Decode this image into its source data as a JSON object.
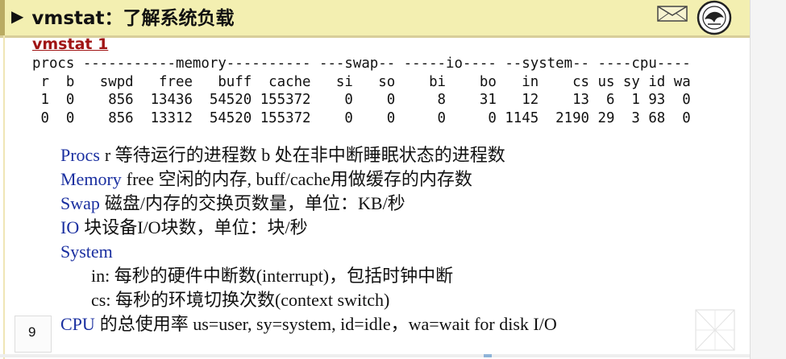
{
  "header": {
    "title_marker": "▶",
    "title": "vmstat：了解系统负载",
    "envelope_icon": "envelope-icon",
    "seal_icon": "university-seal-icon"
  },
  "subtitle": "vmstat 1",
  "terminal": {
    "group_row": "procs -----------memory---------- ---swap-- -----io---- --system-- ----cpu----",
    "header_row": " r  b   swpd   free   buff  cache   si   so    bi    bo   in    cs us sy id wa",
    "rows": [
      " 1  0    856  13436  54520 155372    0    0     8    31   12    13  6  1 93  0",
      " 0  0    856  13312  54520 155372    0    0     0     0 1145  2190 29  3 68  0"
    ]
  },
  "notes": [
    {
      "keyword": "Procs",
      "text": "r 等待运行的进程数 b 处在非中断睡眠状态的进程数"
    },
    {
      "keyword": "Memory",
      "text": "free 空闲的内存, buff/cache用做缓存的内存数"
    },
    {
      "keyword": "Swap",
      "text": "磁盘/内存的交换页数量，单位：KB/秒"
    },
    {
      "keyword": "IO",
      "text": "块设备I/O块数，单位：块/秒"
    },
    {
      "keyword": "System",
      "text": ""
    },
    {
      "keyword": "",
      "text": "in: 每秒的硬件中断数(interrupt)，包括时钟中断"
    },
    {
      "keyword": "",
      "text": "cs: 每秒的环境切换次数(context switch)"
    },
    {
      "keyword": "CPU",
      "text": "的总使用率  us=user,  sy=system, id=idle，wa=wait for disk I/O"
    }
  ],
  "page_number": "9",
  "colors": {
    "header_bg": "#f3efb1",
    "subtitle": "#a01414",
    "keyword": "#1a2fa0"
  }
}
